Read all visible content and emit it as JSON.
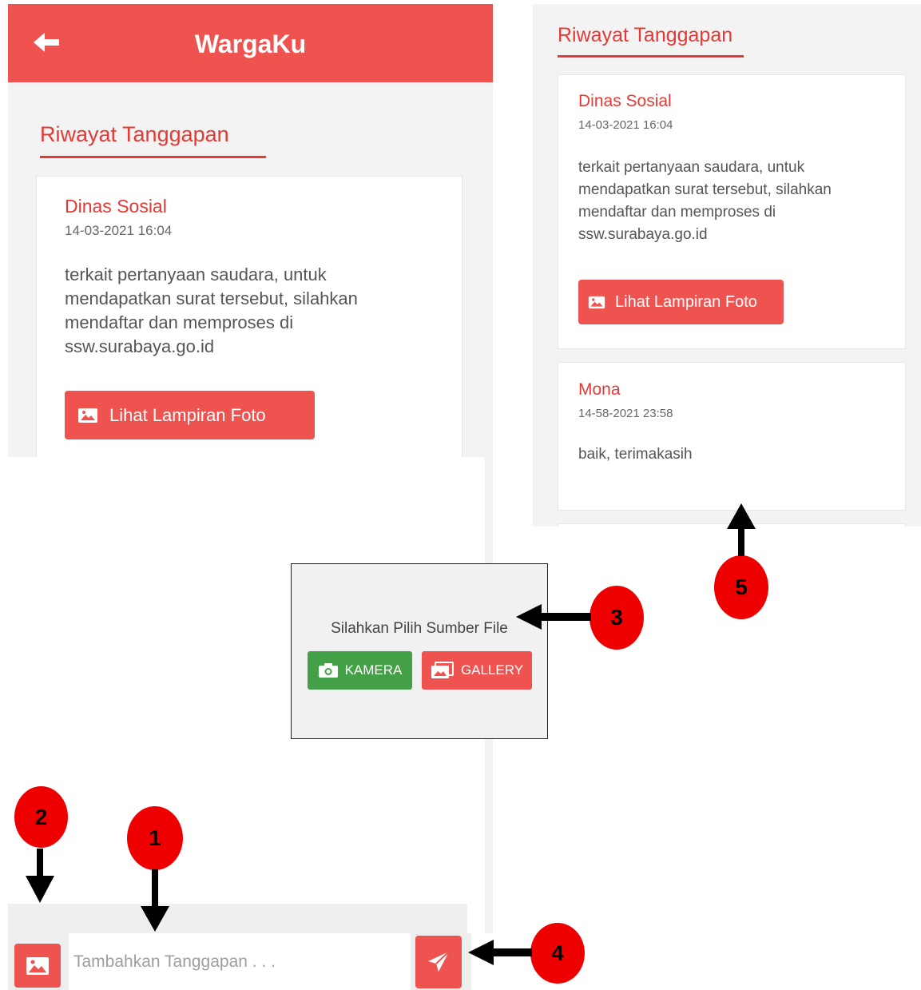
{
  "app": {
    "title": "WargaKu"
  },
  "section_title": "Riwayat Tanggapan",
  "responses": [
    {
      "sender": "Dinas Sosial",
      "date": "14-03-2021 16:04",
      "message": "terkait pertanyaan saudara, untuk mendapatkan surat tersebut, silahkan mendaftar dan memproses di ssw.surabaya.go.id",
      "attachment_label": "Lihat Lampiran Foto"
    },
    {
      "sender": "Mona",
      "date": "14-58-2021 23:58",
      "message": "baik, terimakasih"
    }
  ],
  "dialog": {
    "title": "Silahkan Pilih Sumber File",
    "camera_label": "KAMERA",
    "gallery_label": "GALLERY"
  },
  "composer": {
    "placeholder": "Tambahkan Tanggapan . . ."
  },
  "callouts": [
    "1",
    "2",
    "3",
    "4",
    "5"
  ],
  "colors": {
    "primary": "#ef5350",
    "accent_text": "#e53935",
    "camera_green": "#43a047",
    "callout_red": "#ee0000"
  },
  "icons": [
    "back-arrow-icon",
    "image-icon",
    "camera-icon",
    "gallery-icon",
    "send-icon"
  ]
}
